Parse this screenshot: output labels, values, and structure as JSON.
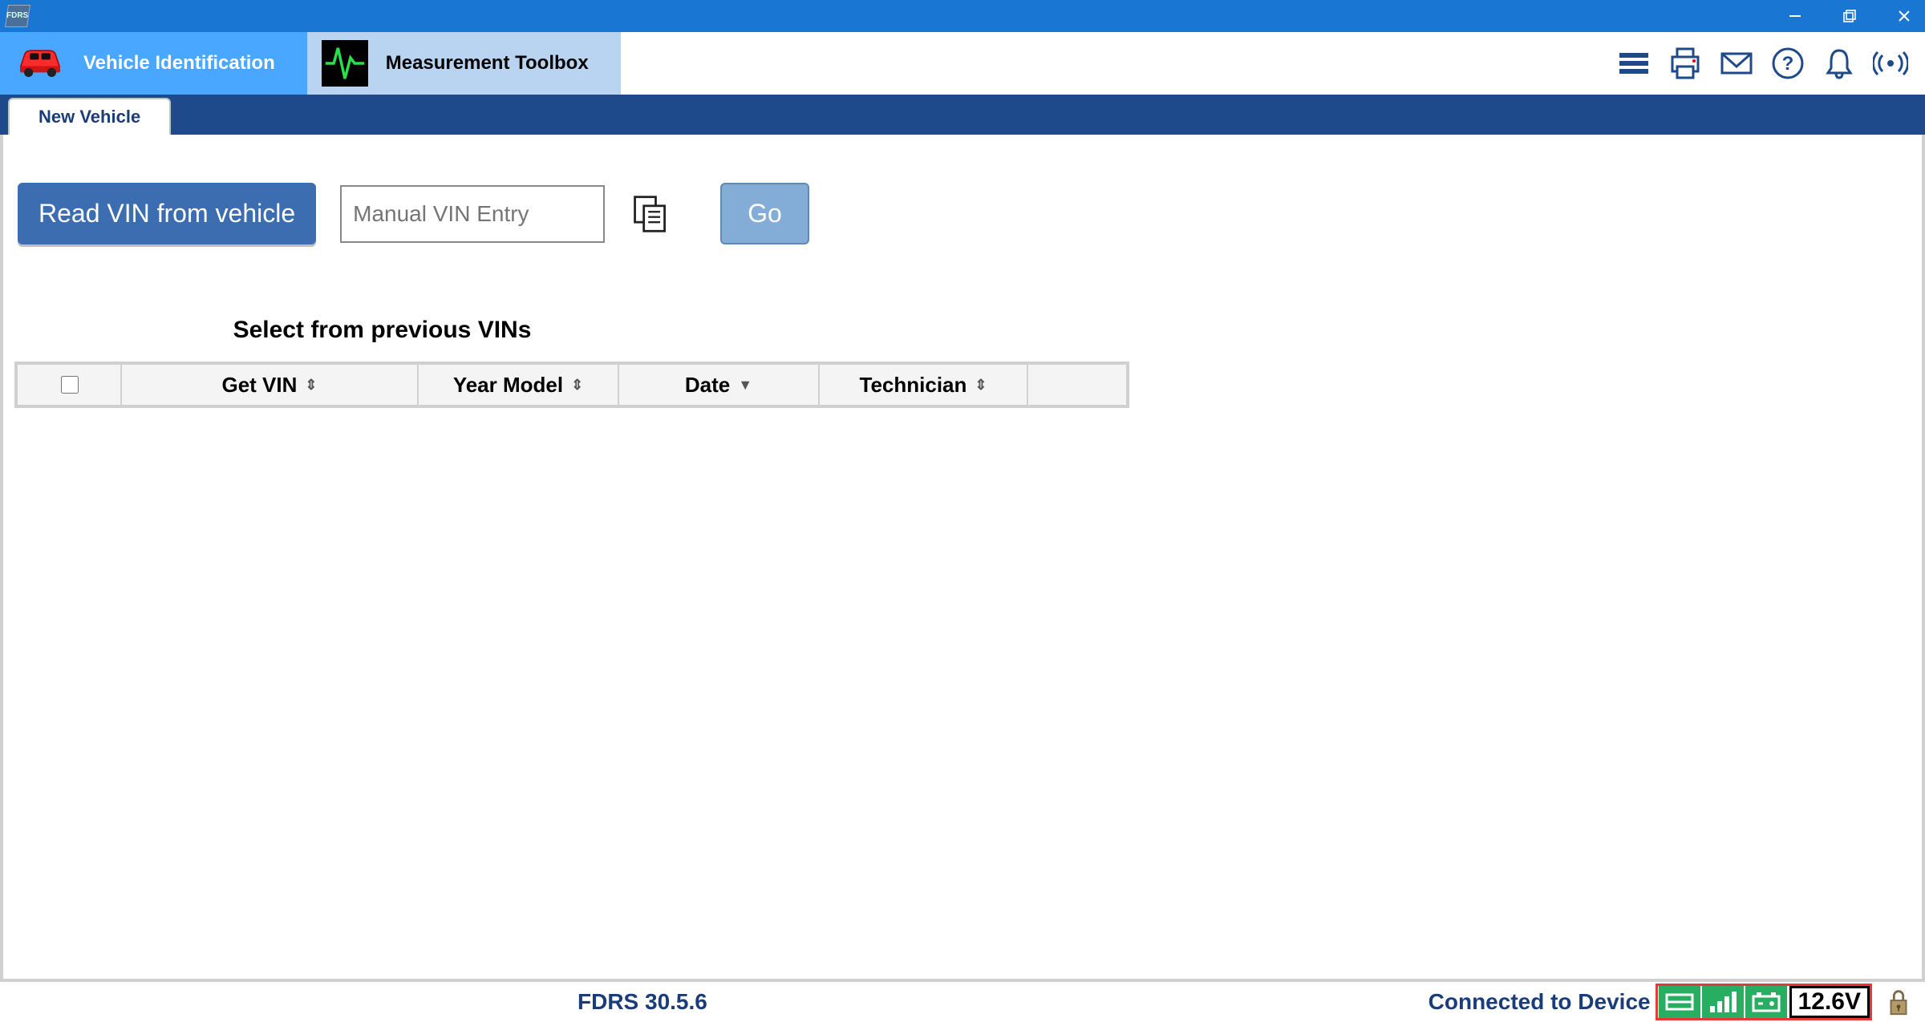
{
  "app_icon_label": "FDRS",
  "ribbon": {
    "tab_vehicle_id": "Vehicle Identification",
    "tab_measurement": "Measurement Toolbox"
  },
  "icon_names": {
    "menu": "menu-icon",
    "print": "printer-icon",
    "mail": "mail-icon",
    "help": "help-icon",
    "bell": "bell-icon",
    "broadcast": "broadcast-icon"
  },
  "subtab": {
    "new_vehicle": "New Vehicle"
  },
  "actions": {
    "read_vin": "Read VIN from vehicle",
    "vin_placeholder": "Manual VIN Entry",
    "vin_value": "",
    "go": "Go"
  },
  "previous": {
    "heading": "Select from previous VINs",
    "columns": {
      "get_vin": "Get VIN",
      "year_model": "Year Model",
      "date": "Date",
      "technician": "Technician"
    }
  },
  "status": {
    "version": "FDRS 30.5.6",
    "device": "Connected to Device",
    "voltage": "12.6V"
  }
}
